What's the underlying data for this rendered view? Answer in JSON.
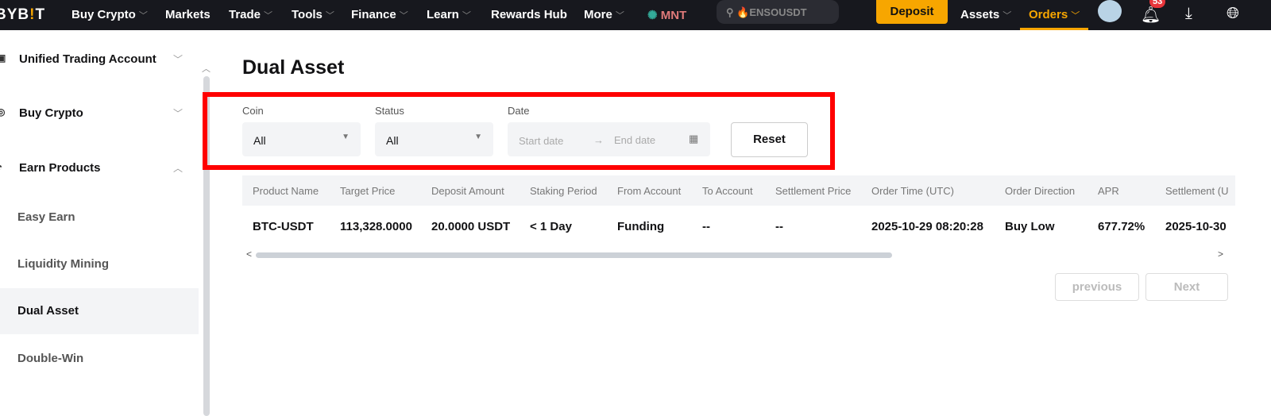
{
  "nav": {
    "logo": "BYBIT",
    "items": [
      "Buy Crypto",
      "Markets",
      "Trade",
      "Tools",
      "Finance",
      "Learn",
      "Rewards Hub",
      "More"
    ],
    "mnt": "MNT",
    "search_placeholder": "ENSOUSDT",
    "deposit": "Deposit",
    "assets": "Assets",
    "orders": "Orders",
    "notifications": "53"
  },
  "sidebar": {
    "groups": [
      "Unified Trading Account",
      "Buy Crypto",
      "Earn Products"
    ],
    "subs": [
      "Easy Earn",
      "Liquidity Mining",
      "Dual Asset",
      "Double-Win"
    ]
  },
  "page": {
    "title": "Dual Asset"
  },
  "filters": {
    "coin_label": "Coin",
    "coin_value": "All",
    "status_label": "Status",
    "status_value": "All",
    "date_label": "Date",
    "start_placeholder": "Start date",
    "end_placeholder": "End date",
    "reset": "Reset"
  },
  "table": {
    "headers": [
      "Product Name",
      "Target Price",
      "Deposit Amount",
      "Staking Period",
      "From Account",
      "To Account",
      "Settlement Price",
      "Order Time (UTC)",
      "Order Direction",
      "APR",
      "Settlement (U"
    ],
    "row": [
      "BTC-USDT",
      "113,328.0000",
      "20.0000 USDT",
      "< 1 Day",
      "Funding",
      "--",
      "--",
      "2025-10-29 08:20:28",
      "Buy Low",
      "677.72%",
      "2025-10-30"
    ]
  },
  "pagination": {
    "previous": "previous",
    "next": "Next"
  },
  "colors": {
    "accent": "#f7a600",
    "highlight": "#ff0000"
  }
}
